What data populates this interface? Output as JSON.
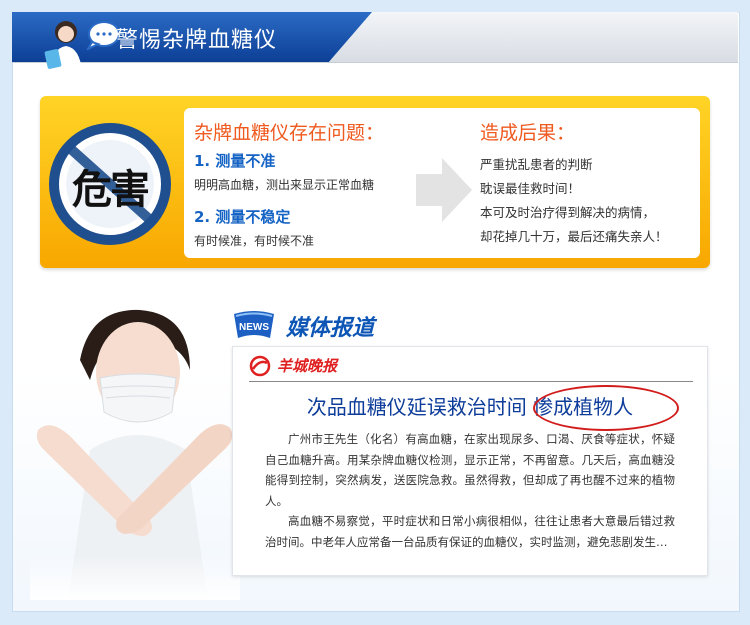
{
  "header": {
    "title": "警惕杂牌血糖仪",
    "avatar_icon": "nurse-avatar-icon",
    "bubble_icon": "speech-bubble-icon"
  },
  "warning": {
    "danger_word": "危害",
    "issues_title": "杂牌血糖仪存在问题：",
    "issues": [
      {
        "head": "1. 测量不准",
        "desc": "明明高血糖，测出来显示正常血糖"
      },
      {
        "head": "2. 测量不稳定",
        "desc": "有时候准，有时候不准"
      }
    ],
    "consequences_title": "造成后果：",
    "consequences": [
      "严重扰乱患者的判断",
      "耽误最佳救时间！",
      "本可及时治疗得到解决的病情，",
      "却花掉几十万，最后还痛失亲人！"
    ]
  },
  "media": {
    "badge": "NEWS",
    "title": "媒体报道",
    "paper_name": "羊城晚报",
    "headline": "次品血糖仪延误救治时间 惨成植物人",
    "paragraphs": [
      "广州市王先生（化名）有高血糖，在家出现尿多、口渴、厌食等症状，怀疑自己血糖升高。用某杂牌血糖仪检测，显示正常，不再留意。几天后，高血糖没能得到控制，突然病发，送医院急救。虽然得救，但却成了再也醒不过来的植物人。",
      "高血糖不易察觉，平时症状和日常小病很相似，往往让患者大意最后错过救治时间。中老年人应常备一台品质有保证的血糖仪，实时监测，避免悲剧发生…"
    ]
  },
  "colors": {
    "brand_blue": "#0d3f96",
    "accent_orange": "#ef5a20",
    "warn_yellow": "#ffd426",
    "alert_red": "#d21c1c"
  }
}
